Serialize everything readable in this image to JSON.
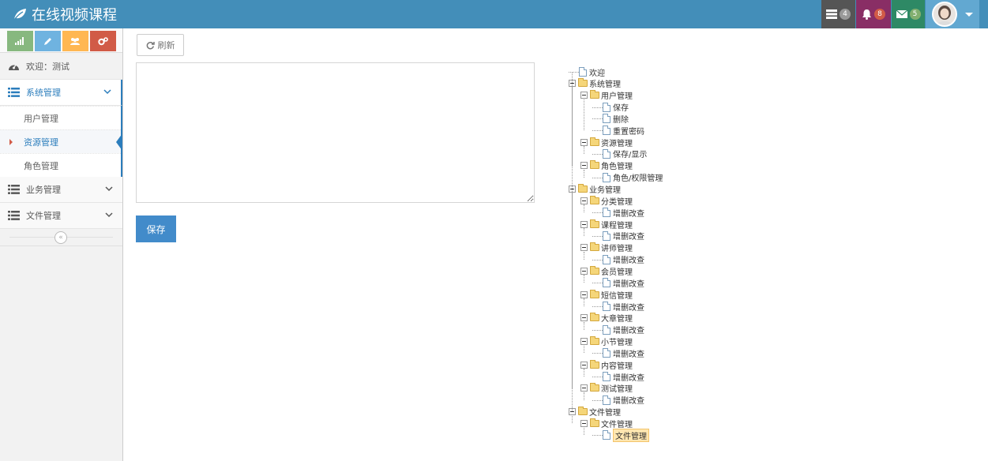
{
  "navbar": {
    "brand": "在线视频课程",
    "tasks_count": "4",
    "notifications_count": "8",
    "messages_count": "5"
  },
  "sidebar": {
    "welcome": "欢迎：测试",
    "menus": [
      {
        "label": "系统管理",
        "sub": [
          "用户管理",
          "资源管理",
          "角色管理"
        ]
      },
      {
        "label": "业务管理"
      },
      {
        "label": "文件管理"
      }
    ]
  },
  "main": {
    "refresh_label": "刷新",
    "textarea_value": "",
    "save_label": "保存"
  },
  "tree": [
    {
      "label": "欢迎",
      "type": "file",
      "level": 0
    },
    {
      "label": "系统管理",
      "type": "folder",
      "level": 0
    },
    {
      "label": "用户管理",
      "type": "folder",
      "level": 1
    },
    {
      "label": "保存",
      "type": "file",
      "level": 2
    },
    {
      "label": "删除",
      "type": "file",
      "level": 2
    },
    {
      "label": "重置密码",
      "type": "file",
      "level": 2
    },
    {
      "label": "资源管理",
      "type": "folder",
      "level": 1
    },
    {
      "label": "保存/显示",
      "type": "file",
      "level": 2
    },
    {
      "label": "角色管理",
      "type": "folder",
      "level": 1
    },
    {
      "label": "角色/权限管理",
      "type": "file",
      "level": 2
    },
    {
      "label": "业务管理",
      "type": "folder",
      "level": 0
    },
    {
      "label": "分类管理",
      "type": "folder",
      "level": 1
    },
    {
      "label": "增删改查",
      "type": "file",
      "level": 2
    },
    {
      "label": "课程管理",
      "type": "folder",
      "level": 1
    },
    {
      "label": "增删改查",
      "type": "file",
      "level": 2
    },
    {
      "label": "讲师管理",
      "type": "folder",
      "level": 1
    },
    {
      "label": "增删改查",
      "type": "file",
      "level": 2
    },
    {
      "label": "会员管理",
      "type": "folder",
      "level": 1
    },
    {
      "label": "增删改查",
      "type": "file",
      "level": 2
    },
    {
      "label": "短信管理",
      "type": "folder",
      "level": 1
    },
    {
      "label": "增删改查",
      "type": "file",
      "level": 2
    },
    {
      "label": "大章管理",
      "type": "folder",
      "level": 1
    },
    {
      "label": "增删改查",
      "type": "file",
      "level": 2
    },
    {
      "label": "小节管理",
      "type": "folder",
      "level": 1
    },
    {
      "label": "增删改查",
      "type": "file",
      "level": 2
    },
    {
      "label": "内容管理",
      "type": "folder",
      "level": 1
    },
    {
      "label": "增删改查",
      "type": "file",
      "level": 2
    },
    {
      "label": "测试管理",
      "type": "folder",
      "level": 1
    },
    {
      "label": "增删改查",
      "type": "file",
      "level": 2
    },
    {
      "label": "文件管理",
      "type": "folder",
      "level": 0
    },
    {
      "label": "文件管理",
      "type": "folder",
      "level": 1
    },
    {
      "label": "文件管理",
      "type": "file",
      "level": 2,
      "selected": true
    }
  ]
}
